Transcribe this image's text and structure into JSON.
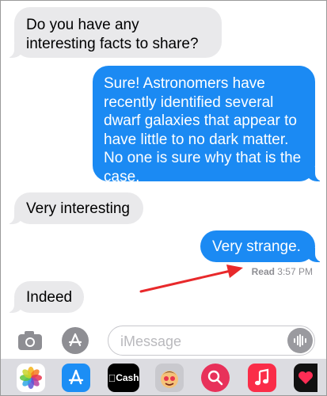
{
  "messages": [
    {
      "direction": "incoming",
      "text": "Do you have any interesting facts to share?"
    },
    {
      "direction": "outgoing",
      "text": "Sure! Astronomers have recently identified several dwarf galaxies that appear to have little to no dark matter. No one is sure why that is the case."
    },
    {
      "direction": "incoming",
      "text": "Very interesting"
    },
    {
      "direction": "outgoing",
      "text": "Very strange."
    },
    {
      "direction": "incoming",
      "text": "Indeed"
    }
  ],
  "receipt": {
    "status": "Read",
    "time": "3:57 PM"
  },
  "composer": {
    "placeholder": "iMessage"
  },
  "apps": {
    "cash_label": "Cash"
  },
  "colors": {
    "outgoing_bubble": "#1b8af3",
    "incoming_bubble": "#e9e9eb",
    "annotation_arrow": "#e8292b"
  },
  "icons": [
    "camera-icon",
    "app-store-icon",
    "audio-waveform-icon",
    "photos-app-icon",
    "app-store-app-icon",
    "apple-cash-app-icon",
    "memoji-app-icon",
    "image-search-app-icon",
    "music-app-icon",
    "digital-touch-app-icon"
  ]
}
